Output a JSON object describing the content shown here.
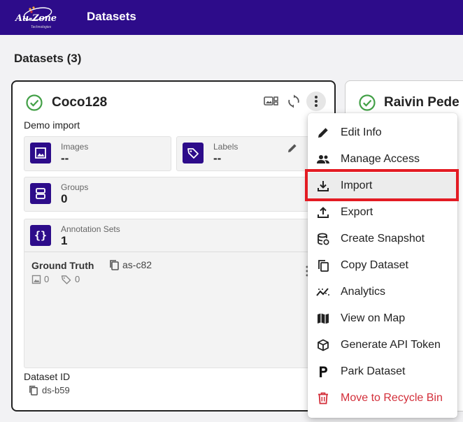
{
  "app": {
    "logo_text": "Au-Zone",
    "logo_sub": "Technologies",
    "title": "Datasets"
  },
  "page": {
    "heading": "Datasets (3)"
  },
  "card1": {
    "title": "Coco128",
    "description": "Demo import",
    "images_label": "Images",
    "images_value": "--",
    "labels_label": "Labels",
    "labels_value": "--",
    "groups_label": "Groups",
    "groups_value": "0",
    "annotation_label": "Annotation Sets",
    "annotation_value": "1",
    "ground_truth": {
      "label": "Ground Truth",
      "id": "as-c82",
      "images": "0",
      "labels": "0"
    },
    "dataset_id_label": "Dataset ID",
    "dataset_id": "ds-b59"
  },
  "card2": {
    "title": "Raivin Pede"
  },
  "menu": {
    "items": [
      {
        "label": "Edit Info",
        "icon": "pencil-icon"
      },
      {
        "label": "Manage Access",
        "icon": "people-icon"
      },
      {
        "label": "Import",
        "icon": "download-icon"
      },
      {
        "label": "Export",
        "icon": "upload-icon"
      },
      {
        "label": "Create Snapshot",
        "icon": "database-icon"
      },
      {
        "label": "Copy Dataset",
        "icon": "copy-icon"
      },
      {
        "label": "Analytics",
        "icon": "analytics-icon"
      },
      {
        "label": "View on Map",
        "icon": "map-icon"
      },
      {
        "label": "Generate API Token",
        "icon": "cube-icon"
      },
      {
        "label": "Park Dataset",
        "icon": "parking-icon"
      },
      {
        "label": "Move to Recycle Bin",
        "icon": "trash-icon"
      }
    ]
  },
  "colors": {
    "brand": "#2d0c8a",
    "success": "#43a047",
    "danger": "#d32f3a",
    "highlight": "#e31b23"
  }
}
